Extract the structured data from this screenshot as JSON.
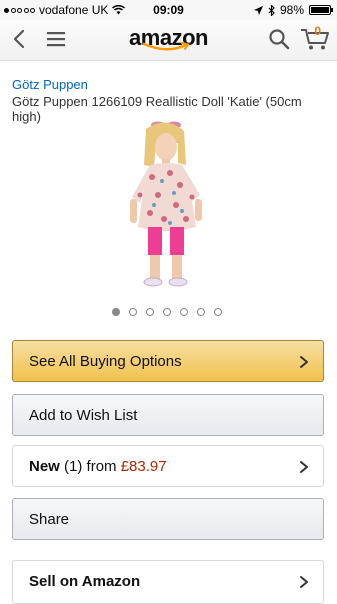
{
  "status_bar": {
    "carrier": "vodafone UK",
    "time": "09:09",
    "battery": "98%",
    "battery_level": 0.98
  },
  "nav": {
    "logo_text": "amazon",
    "cart_count": "0",
    "accent_color": "#ff9900"
  },
  "product": {
    "brand": "Götz Puppen",
    "title": "Götz Puppen 1266109 Reallistic Doll 'Katie' (50cm high)",
    "image_count": 7,
    "active_image": 1
  },
  "actions": {
    "buying_options": "See All Buying Options",
    "wish_list": "Add to Wish List",
    "new_condition": "New",
    "new_count": "(1)",
    "new_from": "from",
    "new_price": "£83.97",
    "share": "Share",
    "sell": "Sell on Amazon"
  }
}
